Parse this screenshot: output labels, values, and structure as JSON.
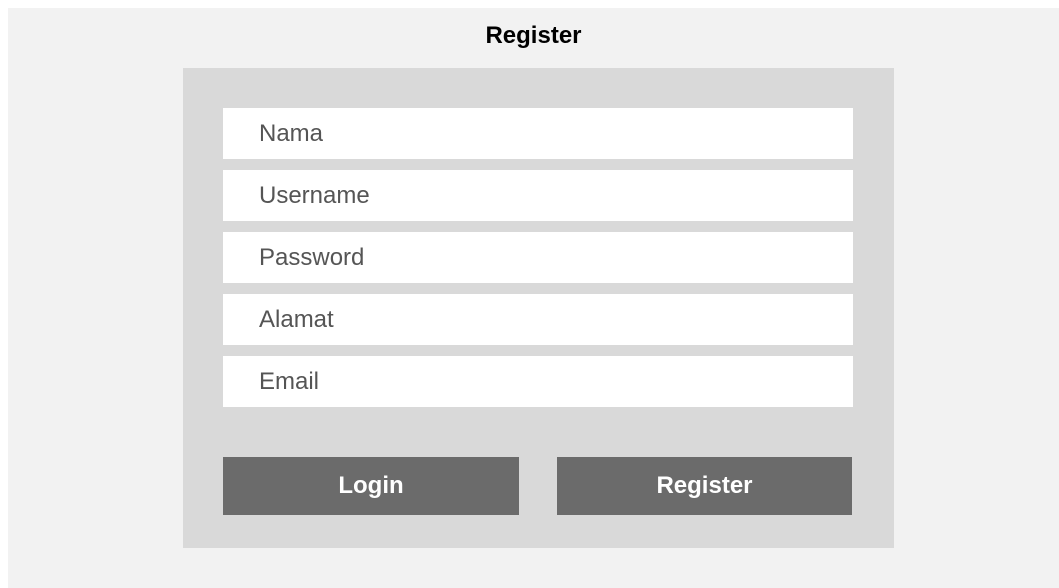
{
  "header": {
    "title": "Register"
  },
  "form": {
    "fields": [
      {
        "placeholder": "Nama",
        "value": ""
      },
      {
        "placeholder": "Username",
        "value": ""
      },
      {
        "placeholder": "Password",
        "value": ""
      },
      {
        "placeholder": "Alamat",
        "value": ""
      },
      {
        "placeholder": "Email",
        "value": ""
      }
    ],
    "buttons": {
      "login_label": "Login",
      "register_label": "Register"
    }
  },
  "colors": {
    "page_background": "#f2f2f2",
    "panel_background": "#d9d9d9",
    "field_background": "#ffffff",
    "button_background": "#6b6b6b",
    "button_text": "#ffffff"
  }
}
